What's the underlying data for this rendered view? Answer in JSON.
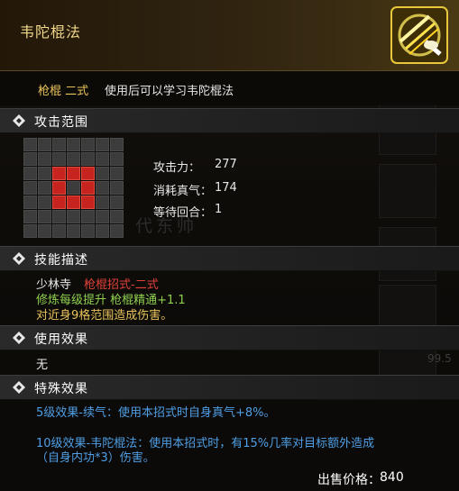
{
  "header": {
    "title": "韦陀棍法",
    "icon": "golden-staff-skill-icon"
  },
  "subheader": {
    "type": "枪棍 二式",
    "description": "使用后可以学习韦陀棍法"
  },
  "sections": {
    "attack_range": "攻击范围",
    "skill_description": "技能描述",
    "usage_effect": "使用效果",
    "special_effect": "特殊效果"
  },
  "attack_grid": {
    "size": 7,
    "highlighted": [
      [
        2,
        2
      ],
      [
        2,
        3
      ],
      [
        2,
        4
      ],
      [
        3,
        2
      ],
      [
        3,
        4
      ],
      [
        4,
        2
      ],
      [
        4,
        3
      ],
      [
        4,
        4
      ]
    ]
  },
  "stats": [
    {
      "label": "攻击力：",
      "value": "277"
    },
    {
      "label": "消耗真气：",
      "value": "174"
    },
    {
      "label": "等待回合：",
      "value": "1"
    }
  ],
  "skill_description": {
    "sect": "少林寺",
    "move_type": "枪棍招式-二式",
    "requirement": "修炼每级提升 枪棍精通+1.1",
    "effect": "对近身9格范围造成伤害。"
  },
  "usage_effect": "无",
  "special_effects": [
    "5级效果-续气：使用本招式时自身真气+8%。",
    "10级效果-韦陀棍法：使用本招式时，有15%几率对目标额外造成",
    "（自身内功*3）伤害。"
  ],
  "price": {
    "label": "出售价格：",
    "value": "840"
  },
  "background": {
    "ghost_text": "代东帅",
    "side_number": "99.5"
  },
  "colors": {
    "title_gold": "#f0d78a",
    "type_gold": "#e8c35a",
    "red": "#e0413a",
    "green": "#8fd14f",
    "yellow": "#e8c35a",
    "blue": "#4f9fe6",
    "grid_on": "#c8241f",
    "grid_off": "#3c3c3c"
  }
}
